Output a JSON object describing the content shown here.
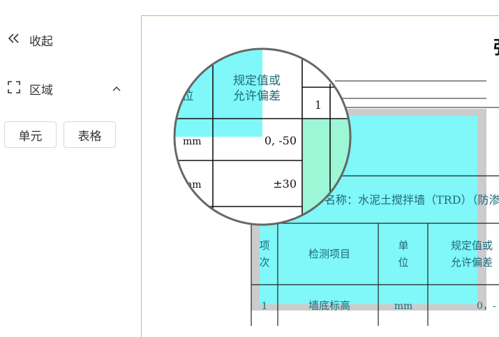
{
  "sidebar": {
    "collapse": {
      "label": "收起",
      "icon": "double-chevron-left-icon"
    },
    "region": {
      "label": "区域",
      "icon": "region-frame-icon",
      "toggle_icon": "chevron-up-icon"
    },
    "buttons": [
      {
        "label": "单元"
      },
      {
        "label": "表格"
      }
    ]
  },
  "document": {
    "title_fragment": "强",
    "table_name": "名称：水泥土搅拌墙（TRD）（防渗",
    "header": {
      "col1": [
        "项",
        "次"
      ],
      "col2": "检测项目",
      "col3": [
        "单",
        "位"
      ],
      "col4": [
        "规定值或",
        "允许偏差"
      ]
    },
    "row1": {
      "index": "1",
      "item": "墙底标高",
      "unit": "mm",
      "value": "0，-"
    }
  },
  "magnifier": {
    "header_col_unit_fragment": "位",
    "header_spec": [
      "规定值或",
      "允许偏差"
    ],
    "side_index": "1",
    "row1": {
      "unit": "mm",
      "value": "0, -50"
    },
    "row2": {
      "unit": "mm",
      "value": "±30"
    }
  },
  "colors": {
    "highlight_cyan": "#80f7f9",
    "highlight_green": "#9cf7d6",
    "selection_gray": "#cccccc",
    "viewer_border": "#a9cd5e",
    "text_teal": "#1c6a78"
  }
}
